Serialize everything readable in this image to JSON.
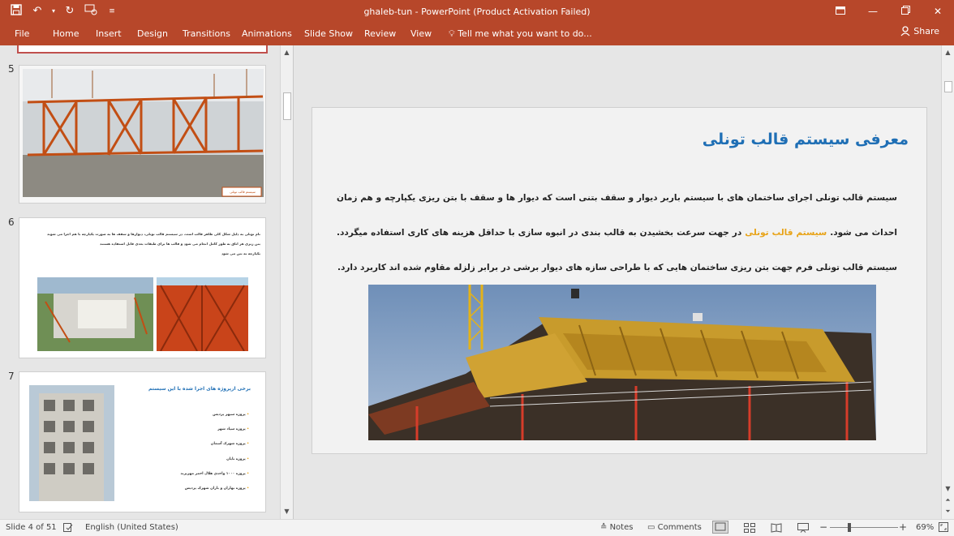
{
  "window": {
    "title": "ghaleb-tun - PowerPoint (Product Activation Failed)"
  },
  "ribbon": {
    "file": "File",
    "tabs": [
      "Home",
      "Insert",
      "Design",
      "Transitions",
      "Animations",
      "Slide Show",
      "Review",
      "View"
    ],
    "tell_me": "Tell me what you want to do...",
    "share": "Share"
  },
  "thumbnails": [
    {
      "number": "5",
      "caption": "سیستم قالب تونلی"
    },
    {
      "number": "6",
      "text_lines": [
        "نام تونلی به دلیل شکل کلی ظاهر قالب است. در سیستم قالب تونلی، دیوارها و سقف ها به صورت یکپارچه با هم اجرا می شوند",
        "بتن ریزی هر اتاق به طور کامل انجام می شود و قالب ها برای طبقات بعدی قابل استفاده هستند",
        "یکپارچه به بتن می شود"
      ]
    },
    {
      "number": "7",
      "title": "برخی ازپروژه های اجرا شده با این سیستم",
      "items": [
        "پروژه سپهر پردیس",
        "پروژه سپاد شهر",
        "پروژه شهرک آسمان",
        "پروژه تابان",
        "پروژه ۱۰۰۰ واحدی هلال احمر مهرپرند",
        "پروژه بهاران و باران شهرک پردیس"
      ]
    }
  ],
  "slide": {
    "title": "معرفی سیستم قالب تونلی",
    "body_start": "سیستم قالب تونلی اجرای ساختمان های با سیستم باربر دیوار و سقف بتنی است که دیوار ها و سقف با بتن ریزی یکپارچه و هم زمان احداث می شود.",
    "body_highlight": "سیستم قالب تونلی",
    "body_end": "در جهت سرعت بخشیدن به قالب بندی در انبوه سازی با حداقل هزینه های کاری استفاده میگردد. سیستم قالب تونلی فرم جهت بتن ریزی ساختمان هایی که با طراحی سازه های دیوار برشی در برابر زلزله مقاوم شده اند کاربرد دارد."
  },
  "status": {
    "slide_of": "Slide 4 of 51",
    "language": "English (United States)",
    "notes": "Notes",
    "comments": "Comments",
    "zoom": "69%"
  },
  "colors": {
    "ribbon": "#b7472a",
    "title_blue": "#1f6fb5",
    "highlight": "#e8a317"
  }
}
